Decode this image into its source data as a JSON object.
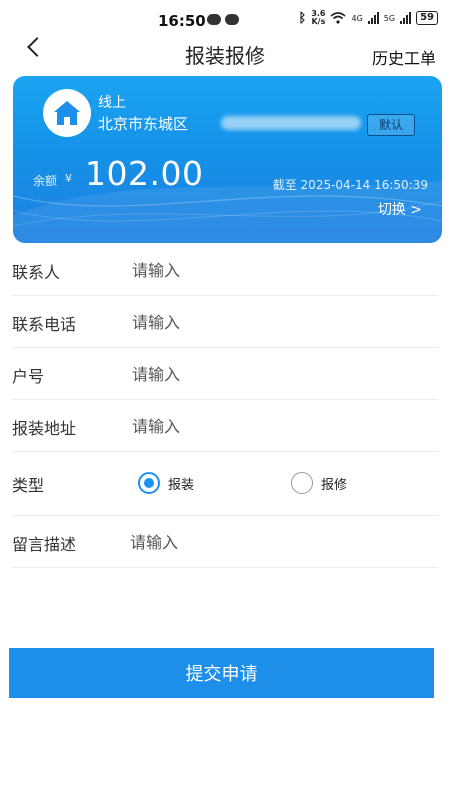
{
  "status_bar": {
    "time": "16:50",
    "net_speed_top": "3.6",
    "net_speed_bottom": "K/s",
    "net1": "4G",
    "net2": "5G",
    "battery": "59"
  },
  "header": {
    "title": "报装报修",
    "history": "历史工单"
  },
  "card": {
    "mode": "线上",
    "address": "北京市东城区",
    "default_badge": "默认",
    "balance_label": "余额",
    "currency": "¥",
    "balance": "102.00",
    "as_of": "截至 2025-04-14 16:50:39",
    "switch": "切换 >"
  },
  "form": {
    "contact": {
      "label": "联系人",
      "placeholder": "请输入"
    },
    "phone": {
      "label": "联系电话",
      "placeholder": "请输入"
    },
    "account": {
      "label": "户号",
      "placeholder": "请输入"
    },
    "install_address": {
      "label": "报装地址",
      "placeholder": "请输入"
    },
    "type": {
      "label": "类型",
      "options": [
        "报装",
        "报修"
      ],
      "selected": "报装"
    },
    "message": {
      "label": "留言描述",
      "placeholder": "请输入"
    }
  },
  "submit": {
    "label": "提交申请"
  },
  "colors": {
    "accent": "#1d8fe8",
    "card_top": "#1ba4f1",
    "card_bottom": "#1e7fe0"
  }
}
